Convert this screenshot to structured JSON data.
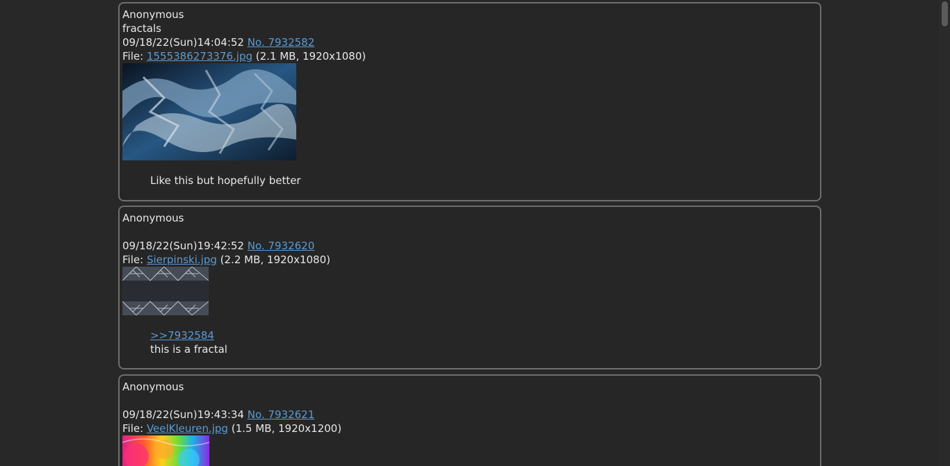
{
  "posts": [
    {
      "name": "Anonymous",
      "subject": "fractals",
      "datetime": "09/18/22(Sun)14:04:52",
      "number": "No. 7932582",
      "file_prefix": "File:",
      "filename": "1555386273376.jpg",
      "fileinfo": "(2.1 MB, 1920x1080)",
      "quote": "",
      "comment": "Like this but hopefully better"
    },
    {
      "name": "Anonymous",
      "subject": "",
      "datetime": "09/18/22(Sun)19:42:52",
      "number": "No. 7932620",
      "file_prefix": "File:",
      "filename": "Sierpinski.jpg",
      "fileinfo": "(2.2 MB, 1920x1080)",
      "quote": ">>7932584",
      "comment": "this is a fractal"
    },
    {
      "name": "Anonymous",
      "subject": "",
      "datetime": "09/18/22(Sun)19:43:34",
      "number": "No. 7932621",
      "file_prefix": "File:",
      "filename": "VeelKleuren.jpg",
      "fileinfo": "(1.5 MB, 1920x1200)",
      "quote": "",
      "comment": ""
    }
  ]
}
